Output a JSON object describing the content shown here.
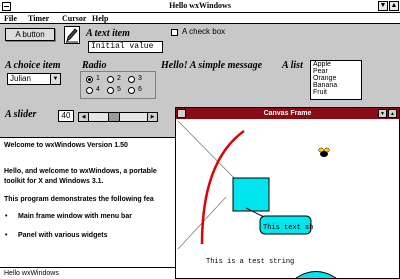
{
  "window": {
    "title": "Hello wxWindows"
  },
  "menu": {
    "items": [
      "File",
      "Timer",
      "Cursor",
      "Help"
    ]
  },
  "panel": {
    "button_label": "A button",
    "text_item_label": "A text item",
    "text_item_value": "Initial value",
    "checkbox_label": "A check box",
    "choice_label": "A choice item",
    "choice_value": "Julian",
    "radio_label": "Radio",
    "radio_options": [
      "1",
      "2",
      "3",
      "4",
      "5",
      "6"
    ],
    "radio_selected": "1",
    "message": "Hello! A simple message",
    "list_label": "A list",
    "list_items": [
      "Apple",
      "Pear",
      "Orange",
      "Banana",
      "Fruit"
    ],
    "slider_label": "A slider",
    "slider_value": "40",
    "slider_fraction": 0.4
  },
  "text_window": {
    "lines": [
      "Welcome to wxWindows Version 1.50",
      "Hello, and welcome to wxWindows, a portable",
      "toolkit for X and Windows 3.1.",
      "This program demonstrates the following fea",
      "Main frame window with menu bar",
      "Panel with various widgets"
    ]
  },
  "status": {
    "text": "Hello wxWindows"
  },
  "canvas": {
    "title": "Canvas Frame",
    "rounded_rect_text": "This text sh",
    "bottom_text": "This is a test string",
    "colors": {
      "title_bar": "#8b0b14",
      "rect_fill": "#00e5ee",
      "curve": "#e00000"
    }
  }
}
